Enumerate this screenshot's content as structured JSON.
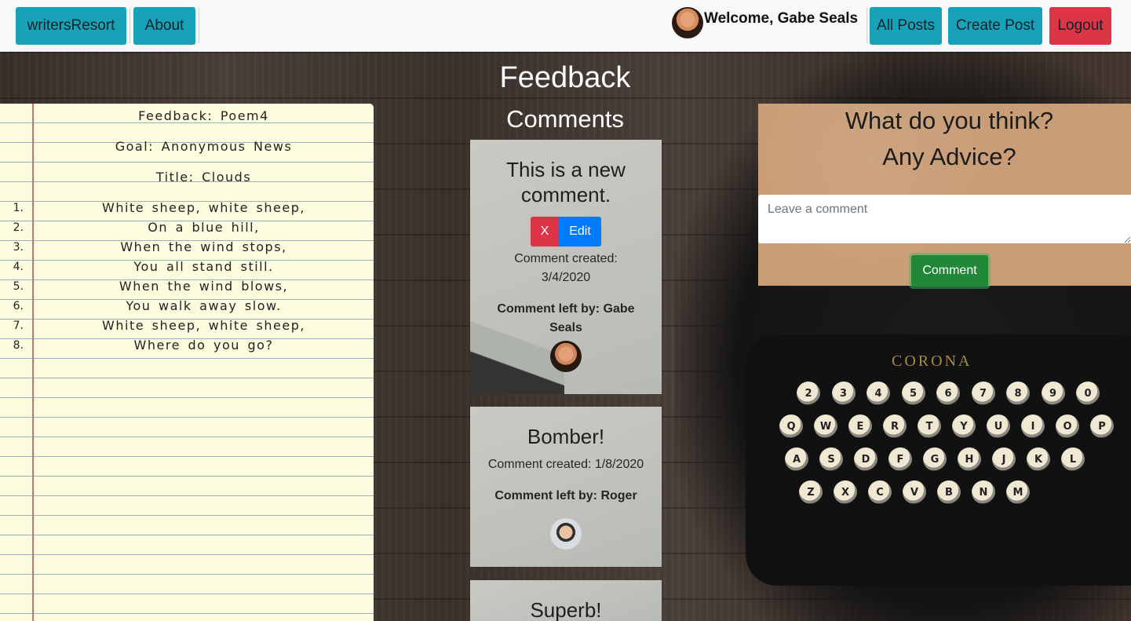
{
  "navbar": {
    "brand": "writersResort",
    "about": "About",
    "welcome": "Welcome, Gabe Seals",
    "all_posts": "All Posts",
    "create_post": "Create Post",
    "logout": "Logout"
  },
  "notebook": {
    "feedback_line": "Feedback: Poem4",
    "goal_line": "Goal: Anonymous News",
    "title_line": "Title: Clouds",
    "poem": [
      {
        "num": "1.",
        "text": "White sheep, white sheep,"
      },
      {
        "num": "2.",
        "text": "On a blue hill,"
      },
      {
        "num": "3.",
        "text": "When the wind stops,"
      },
      {
        "num": "4.",
        "text": "You all stand still."
      },
      {
        "num": "5.",
        "text": "When the wind blows,"
      },
      {
        "num": "6.",
        "text": "You walk away slow."
      },
      {
        "num": "7.",
        "text": "White sheep, white sheep,"
      },
      {
        "num": "8.",
        "text": "Where do you go?"
      }
    ]
  },
  "main": {
    "heading": "Feedback",
    "subheading": "Comments",
    "comments": [
      {
        "text": "This is a new comment.",
        "delete_label": "X",
        "edit_label": "Edit",
        "created": "Comment created: 3/4/2020",
        "author": "Comment left by: Gabe Seals"
      },
      {
        "text": "Bomber!",
        "created": "Comment created: 1/8/2020",
        "author": "Comment left by: Roger"
      },
      {
        "text": "Superb!"
      }
    ]
  },
  "advice": {
    "line1": "What do you think?",
    "line2": "Any Advice?",
    "placeholder": "Leave a comment",
    "button": "Comment"
  },
  "typewriter": {
    "brand": "CORONA",
    "keys_row1": [
      "2",
      "3",
      "4",
      "5",
      "6",
      "7",
      "8",
      "9",
      "0"
    ],
    "keys_row2": [
      "Q",
      "W",
      "E",
      "R",
      "T",
      "Y",
      "U",
      "I",
      "O",
      "P"
    ],
    "keys_row3": [
      "A",
      "S",
      "D",
      "F",
      "G",
      "H",
      "J",
      "K",
      "L"
    ],
    "keys_row4": [
      "Z",
      "X",
      "C",
      "V",
      "B",
      "N",
      "M"
    ]
  },
  "colors": {
    "info": "#17a2b8",
    "danger": "#dc3545",
    "primary": "#007bff",
    "success": "#218838"
  }
}
